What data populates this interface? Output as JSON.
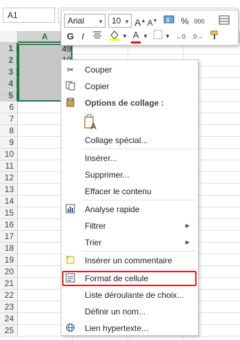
{
  "namebox": {
    "value": "A1"
  },
  "grid": {
    "column_headers": [
      "A"
    ],
    "row_headers": [
      "1",
      "2",
      "3",
      "4",
      "5",
      "6",
      "7",
      "8",
      "9",
      "10",
      "11",
      "12",
      "13",
      "14",
      "15",
      "16",
      "17",
      "18",
      "19",
      "20",
      "21",
      "22",
      "23",
      "24",
      "25"
    ],
    "visible_values": [
      "49",
      "10"
    ]
  },
  "minibar": {
    "font_name": "Arial",
    "font_size": "10",
    "buttons": [
      "grow-font",
      "shrink-font",
      "number-format",
      "percent",
      "thousands",
      "format-table",
      "bold",
      "italic",
      "align-center",
      "fill-color",
      "font-color",
      "borders",
      "increase-decimal",
      "decrease-decimal",
      "format-painter"
    ],
    "fill_color": "#ffff00",
    "font_color": "#ff0000",
    "grow_label": "A",
    "shrink_label": "A",
    "percent_label": "%",
    "thousands_label": "000",
    "bold_label": "G",
    "italic_label": "I",
    "fontcolor_label": "A"
  },
  "context_menu": {
    "items": [
      {
        "label": "Couper",
        "icon": "scissors-icon"
      },
      {
        "label": "Copier",
        "icon": "copy-icon"
      },
      {
        "label": "Options de collage :",
        "icon": "paste-icon"
      },
      {
        "label": "",
        "icon": "paste-values-icon"
      },
      {
        "label": "Collage spécial...",
        "icon": ""
      },
      {
        "label": "Insérer...",
        "icon": ""
      },
      {
        "label": "Supprimer...",
        "icon": ""
      },
      {
        "label": "Effacer le contenu",
        "icon": ""
      },
      {
        "label": "Analyse rapide",
        "icon": "quick-analysis-icon"
      },
      {
        "label": "Filtrer",
        "icon": ""
      },
      {
        "label": "Trier",
        "icon": ""
      },
      {
        "label": "Insérer un commentaire",
        "icon": "comment-icon"
      },
      {
        "label": "Format de cellule",
        "icon": "format-cells-icon"
      },
      {
        "label": "Liste déroulante de choix...",
        "icon": ""
      },
      {
        "label": "Définir un nom...",
        "icon": ""
      },
      {
        "label": "Lien hypertexte...",
        "icon": "hyperlink-icon"
      }
    ],
    "highlighted": "Format de cellule",
    "highlight_color": "#d01f1f",
    "accent_color": "#217346"
  }
}
